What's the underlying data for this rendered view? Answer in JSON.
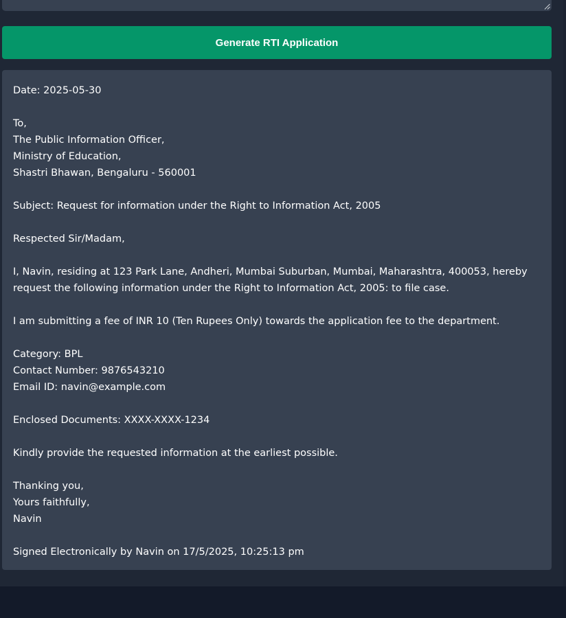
{
  "generate_button": {
    "label": "Generate RTI Application"
  },
  "application": {
    "date_line": "Date: 2025-05-30",
    "to": "To,",
    "officer": "The Public Information Officer,",
    "ministry": "Ministry of Education,",
    "address": "Shastri Bhawan, Bengaluru - 560001",
    "subject": "Subject: Request for information under the Right to Information Act, 2005",
    "salutation": "Respected Sir/Madam,",
    "body_line_1": "I, Navin, residing at 123 Park Lane, Andheri, Mumbai Suburban, Mumbai, Maharashtra, 400053, hereby",
    "body_line_2": "request the following information under the Right to Information Act, 2005: to file case.",
    "fee": "I am submitting a fee of INR 10 (Ten Rupees Only) towards the application fee to the department.",
    "category": "Category: BPL",
    "contact": "Contact Number: 9876543210",
    "email": "Email ID: navin@example.com",
    "enclosed": "Enclosed Documents: XXXX-XXXX-1234",
    "request": "Kindly provide the requested information at the earliest possible.",
    "thanks": "Thanking you,",
    "closing": "Yours faithfully,",
    "name": "Navin",
    "signature": "Signed Electronically by Navin on 17/5/2025, 10:25:13 pm"
  }
}
